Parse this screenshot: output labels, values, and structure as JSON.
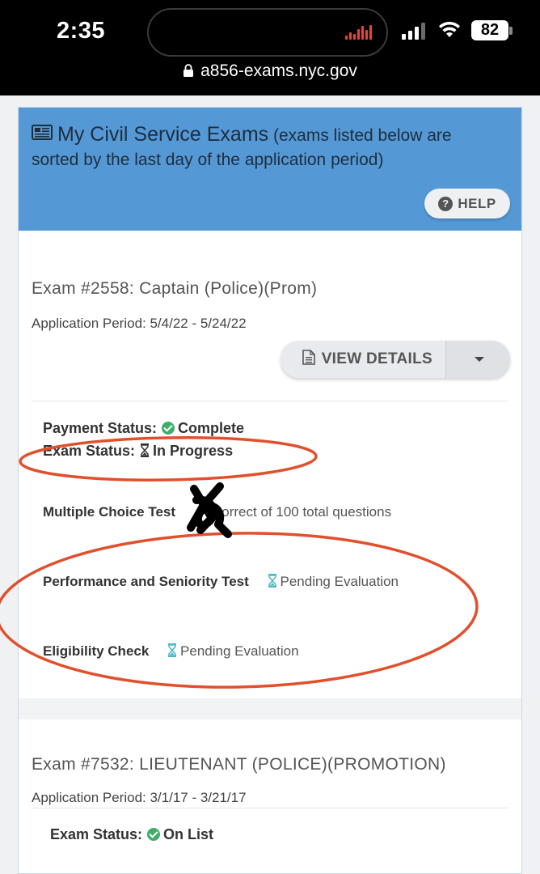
{
  "status_bar": {
    "time": "2:35",
    "battery": "82",
    "url": "a856-exams.nyc.gov"
  },
  "header": {
    "title": "My Civil Service Exams",
    "subtitle": "(exams listed below are sorted by the last day of the application period)",
    "help_label": "HELP",
    "color": "#5499d6"
  },
  "exams": [
    {
      "title": "Exam #2558: Captain (Police)(Prom)",
      "application_period": "Application Period: 5/4/22 - 5/24/22",
      "view_details_label": "VIEW DETAILS",
      "payment_status_label": "Payment Status:",
      "payment_status_value": "Complete",
      "exam_status_label": "Exam Status:",
      "exam_status_value": "In Progress",
      "tests": [
        {
          "label": "Multiple Choice Test",
          "value": "correct of 100 total questions"
        },
        {
          "label": "Performance and Seniority Test",
          "value": "Pending Evaluation"
        },
        {
          "label": "Eligibility Check",
          "value": "Pending Evaluation"
        }
      ]
    },
    {
      "title": "Exam #7532: LIEUTENANT (POLICE)(PROMOTION)",
      "application_period": "Application Period: 3/1/17 - 3/21/17",
      "exam_status_label": "Exam Status:",
      "exam_status_value": "On List"
    }
  ],
  "annotation_color": "#e0502d"
}
